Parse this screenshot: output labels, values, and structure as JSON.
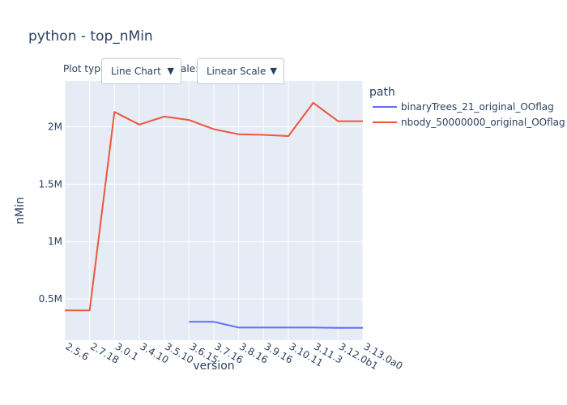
{
  "title": "python - top_nMin",
  "controls": {
    "plot_type_label": "Plot type",
    "scale_label": "ale:",
    "plot_type_value": "Line Chart",
    "scale_value": "Linear Scale",
    "arrow_glyph": "▼"
  },
  "legend": {
    "title": "path"
  },
  "chart_data": {
    "type": "line",
    "title": "python - top_nMin",
    "xlabel": "version",
    "ylabel": "nMin",
    "categories": [
      "2.5.6",
      "2.7.18",
      "3.0.1",
      "3.4.10",
      "3.5.10",
      "3.6.15",
      "3.7.16",
      "3.8.16",
      "3.9.16",
      "3.10.11",
      "3.11.3",
      "3.12.0b1",
      "3.13.0a0"
    ],
    "yticks": [
      {
        "value": 500000,
        "label": "0.5M"
      },
      {
        "value": 1000000,
        "label": "1M"
      },
      {
        "value": 1500000,
        "label": "1.5M"
      },
      {
        "value": 2000000,
        "label": "2M"
      }
    ],
    "ylim": [
      140000,
      2400000
    ],
    "grid": true,
    "legend_position": "right",
    "series": [
      {
        "name": "binaryTrees_21_original_OOflag",
        "color": "#636efa",
        "values": [
          null,
          null,
          null,
          null,
          null,
          300000,
          300000,
          250000,
          250000,
          250000,
          250000,
          248000,
          247000
        ]
      },
      {
        "name": "nbody_50000000_original_OOflag",
        "color": "#ef553b",
        "values": [
          400000,
          400000,
          2130000,
          2020000,
          2090000,
          2060000,
          1980000,
          1935000,
          1930000,
          1920000,
          2210000,
          2050000,
          2050000
        ]
      }
    ]
  }
}
